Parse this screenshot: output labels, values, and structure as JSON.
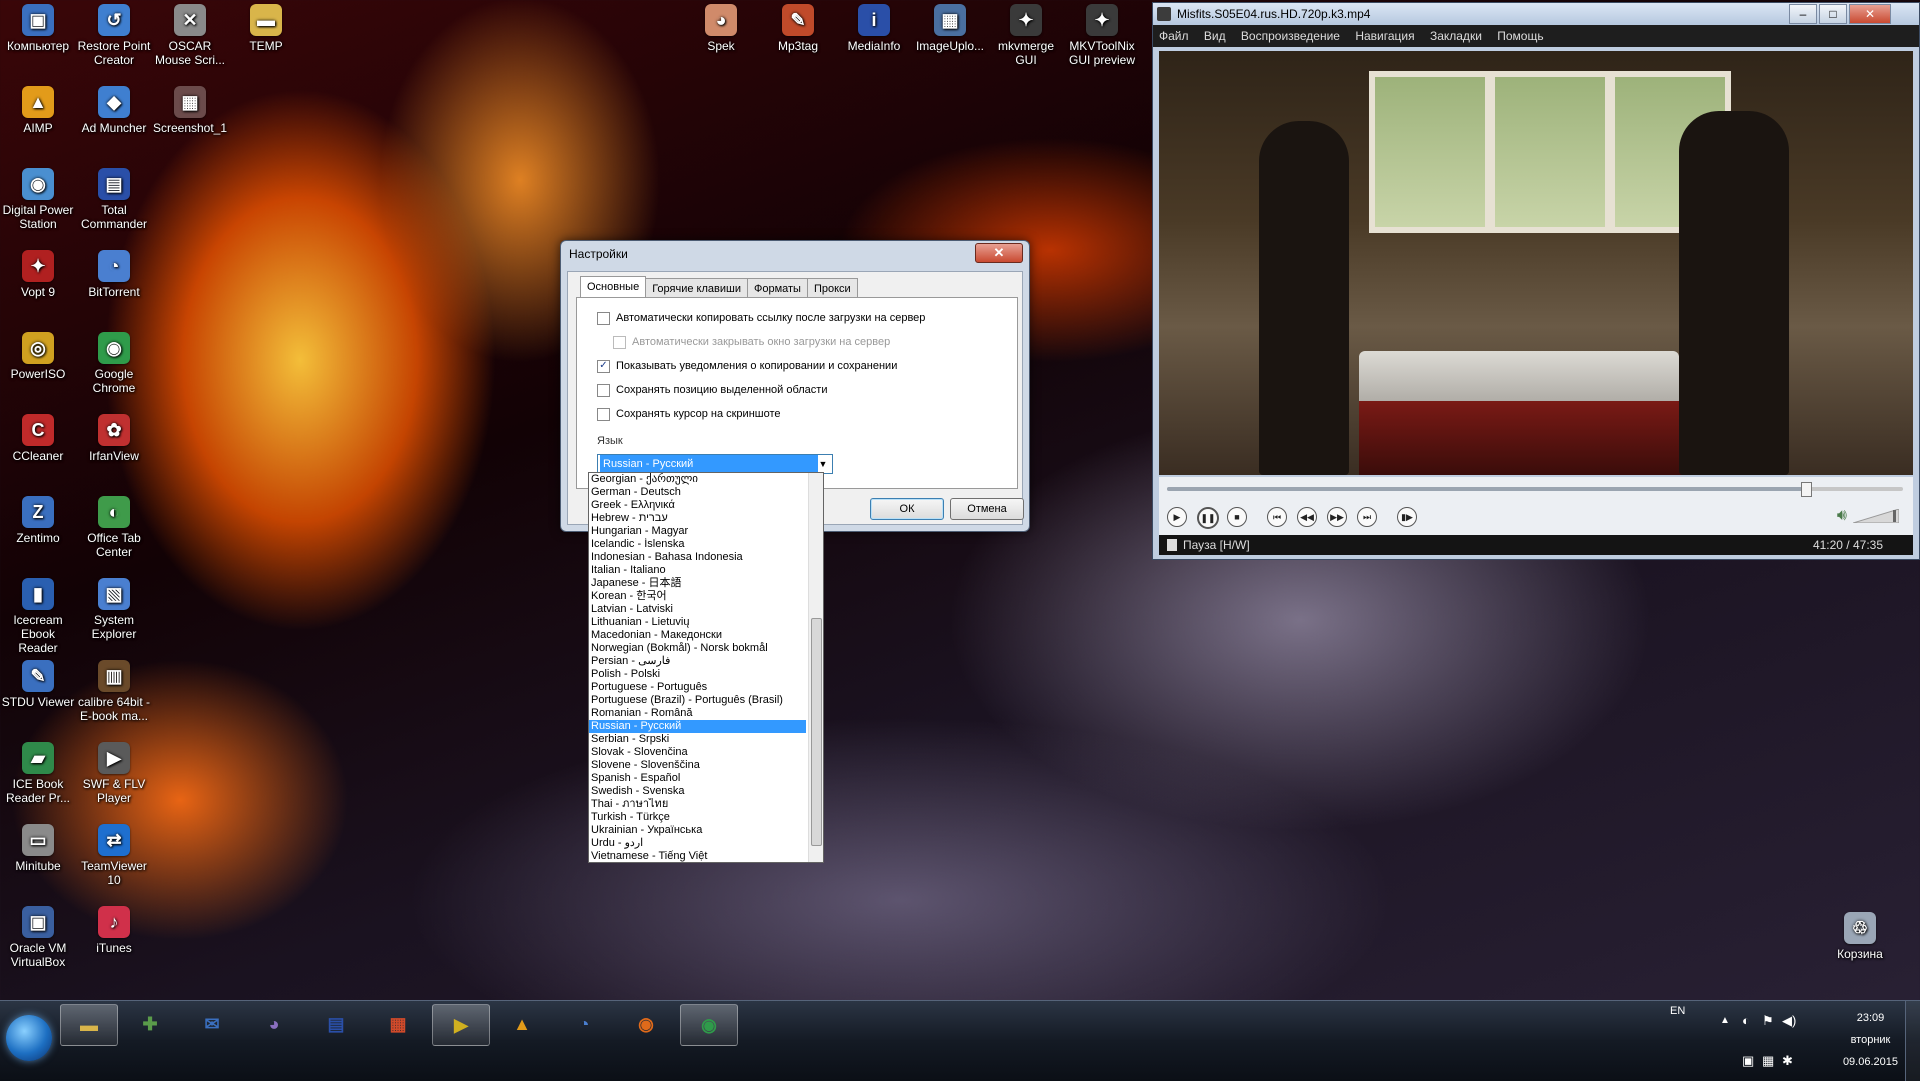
{
  "desktop_icons": [
    {
      "label": "Компьютер",
      "name": "computer-icon",
      "color": "#3a6fbf",
      "glyph": "▣"
    },
    {
      "label": "Restore Point Creator",
      "name": "restore-point-icon",
      "color": "#3f7fd0",
      "glyph": "↺"
    },
    {
      "label": "OSCAR Mouse Scri...",
      "name": "oscar-mouse-icon",
      "color": "#8a8a8a",
      "glyph": "✕"
    },
    {
      "label": "TEMP",
      "name": "folder-icon",
      "color": "#d9b54a",
      "glyph": "▬"
    },
    {
      "label": "AIMP",
      "name": "aimp-icon",
      "color": "#e29b1a",
      "glyph": "▲"
    },
    {
      "label": "Ad Muncher",
      "name": "ad-muncher-icon",
      "color": "#3f7fd0",
      "glyph": "◆"
    },
    {
      "label": "Screenshot_1",
      "name": "screenshot-icon",
      "color": "#6b4b4b",
      "glyph": "▦"
    },
    {
      "label": "Digital Power Station",
      "name": "power-station-icon",
      "color": "#4a8fd0",
      "glyph": "◉"
    },
    {
      "label": "Total Commander",
      "name": "total-commander-icon",
      "color": "#2a4fa8",
      "glyph": "▤"
    },
    {
      "label": "Vopt 9",
      "name": "vopt-icon",
      "color": "#b02020",
      "glyph": "✦"
    },
    {
      "label": "BitTorrent",
      "name": "bittorrent-icon",
      "color": "#4a7fd0",
      "glyph": "◔"
    },
    {
      "label": "PowerISO",
      "name": "poweriso-icon",
      "color": "#d0a020",
      "glyph": "◎"
    },
    {
      "label": "Google Chrome",
      "name": "chrome-icon",
      "color": "#2f9b4a",
      "glyph": "◉"
    },
    {
      "label": "CCleaner",
      "name": "ccleaner-icon",
      "color": "#c02a2a",
      "glyph": "C"
    },
    {
      "label": "IrfanView",
      "name": "irfanview-icon",
      "color": "#c03030",
      "glyph": "✿"
    },
    {
      "label": "Zentimo",
      "name": "zentimo-icon",
      "color": "#3a6fbf",
      "glyph": "Z"
    },
    {
      "label": "Office Tab Center",
      "name": "office-tab-icon",
      "color": "#3f9b4a",
      "glyph": "◐"
    },
    {
      "label": "Icecream Ebook Reader",
      "name": "icecream-icon",
      "color": "#2a5fb0",
      "glyph": "▮"
    },
    {
      "label": "System Explorer",
      "name": "system-explorer-icon",
      "color": "#4a7fd0",
      "glyph": "▧"
    },
    {
      "label": "STDU Viewer",
      "name": "stdu-viewer-icon",
      "color": "#3a6fbf",
      "glyph": "✎"
    },
    {
      "label": "calibre 64bit - E-book ma...",
      "name": "calibre-icon",
      "color": "#6a4a2a",
      "glyph": "▥"
    },
    {
      "label": "ICE Book Reader Pr...",
      "name": "ice-book-icon",
      "color": "#2f8a4a",
      "glyph": "▰"
    },
    {
      "label": "SWF & FLV Player",
      "name": "swf-player-icon",
      "color": "#5a5a5a",
      "glyph": "▶"
    },
    {
      "label": "Minitube",
      "name": "minitube-icon",
      "color": "#8a8a8a",
      "glyph": "▭"
    },
    {
      "label": "TeamViewer 10",
      "name": "teamviewer-icon",
      "color": "#1e6fcf",
      "glyph": "⇄"
    },
    {
      "label": "Oracle VM VirtualBox",
      "name": "virtualbox-icon",
      "color": "#3a5f9f",
      "glyph": "▣"
    },
    {
      "label": "iTunes",
      "name": "itunes-icon",
      "color": "#d0304a",
      "glyph": "♪"
    },
    {
      "label": "Spek",
      "name": "spek-icon",
      "color": "#d08a6a",
      "glyph": "◕"
    },
    {
      "label": "Mp3tag",
      "name": "mp3tag-icon",
      "color": "#c04a2a",
      "glyph": "✎"
    },
    {
      "label": "MediaInfo",
      "name": "mediainfo-icon",
      "color": "#2a4fa8",
      "glyph": "i"
    },
    {
      "label": "ImageUplo...",
      "name": "imageuploader-icon",
      "color": "#4a6fa0",
      "glyph": "▦"
    },
    {
      "label": "mkvmerge GUI",
      "name": "mkvmerge-icon",
      "color": "#3a3a3a",
      "glyph": "✦"
    },
    {
      "label": "MKVToolNix GUI preview",
      "name": "mkvtoolnix-icon",
      "color": "#3a3a3a",
      "glyph": "✦"
    },
    {
      "label": "Корзина",
      "name": "recycle-bin-icon",
      "color": "#9aa6b6",
      "glyph": "♲"
    }
  ],
  "dialog": {
    "title": "Настройки",
    "close_glyph": "✕",
    "tabs": [
      "Основные",
      "Горячие клавиши",
      "Форматы",
      "Прокси"
    ],
    "options": [
      {
        "label": "Автоматически копировать ссылку после загрузки на сервер",
        "checked": false,
        "disabled": false
      },
      {
        "label": "Автоматически закрывать окно загрузки на сервер",
        "checked": false,
        "disabled": true
      },
      {
        "label": "Показывать уведомления о копировании и сохранении",
        "checked": true,
        "disabled": false
      },
      {
        "label": "Сохранять позицию выделенной области",
        "checked": false,
        "disabled": false
      },
      {
        "label": "Сохранять курсор на скриншоте",
        "checked": false,
        "disabled": false
      }
    ],
    "language_label": "Язык",
    "language_selected": "Russian - Русский",
    "ok_label": "ОК",
    "cancel_label": "Отмена"
  },
  "language_options": [
    "Georgian - ქართული",
    "German - Deutsch",
    "Greek - Ελληνικά",
    "Hebrew - עברית",
    "Hungarian - Magyar",
    "Icelandic - Íslenska",
    "Indonesian - Bahasa Indonesia",
    "Italian - Italiano",
    "Japanese - 日本語",
    "Korean - 한국어",
    "Latvian - Latviski",
    "Lithuanian - Lietuvių",
    "Macedonian - Македонски",
    "Norwegian (Bokmål) - Norsk bokmål",
    "Persian - فارسی",
    "Polish - Polski",
    "Portuguese - Português",
    "Portuguese (Brazil) - Português (Brasil)",
    "Romanian - Română",
    "Russian - Русский",
    "Serbian - Srpski",
    "Slovak - Slovenčina",
    "Slovene - Slovenščina",
    "Spanish - Español",
    "Swedish - Svenska",
    "Thai - ภาษาไทย",
    "Turkish - Türkçe",
    "Ukrainian - Українська",
    "Urdu - اردو",
    "Vietnamese - Tiếng Việt"
  ],
  "player": {
    "title": "Misfits.S05E04.rus.HD.720p.k3.mp4",
    "menu": [
      "Файл",
      "Вид",
      "Воспроизведение",
      "Навигация",
      "Закладки",
      "Помощь"
    ],
    "status": "Пауза [H/W]",
    "time": "41:20 / 47:35",
    "progress": 0.8687
  },
  "taskbar": {
    "items": [
      {
        "name": "explorer-taskbar-icon",
        "glyph": "▬",
        "color": "#d9b54a",
        "active": true
      },
      {
        "name": "app-taskbar-icon",
        "glyph": "✚",
        "color": "#5a9b4a",
        "active": false
      },
      {
        "name": "thunderbird-taskbar-icon",
        "glyph": "✉",
        "color": "#3a6fbf",
        "active": false
      },
      {
        "name": "pidgin-taskbar-icon",
        "glyph": "◕",
        "color": "#8a6fbf",
        "active": false
      },
      {
        "name": "save-taskbar-icon",
        "glyph": "▤",
        "color": "#2a4fa8",
        "active": false
      },
      {
        "name": "apps-grid-taskbar-icon",
        "glyph": "▦",
        "color": "#d04a2a",
        "active": false
      },
      {
        "name": "media-player-taskbar-icon",
        "glyph": "▶",
        "color": "#d0b020",
        "active": true
      },
      {
        "name": "aimp-taskbar-icon",
        "glyph": "▲",
        "color": "#e29b1a",
        "active": false
      },
      {
        "name": "bittorrent-taskbar-icon",
        "glyph": "◔",
        "color": "#4a7fd0",
        "active": false
      },
      {
        "name": "firefox-taskbar-icon",
        "glyph": "◉",
        "color": "#e06a1a",
        "active": false
      },
      {
        "name": "chrome-taskbar-icon",
        "glyph": "◉",
        "color": "#2f9b4a",
        "active": true
      }
    ],
    "lang": "EN",
    "time": "23:09",
    "day": "вторник",
    "date": "09.06.2015"
  }
}
